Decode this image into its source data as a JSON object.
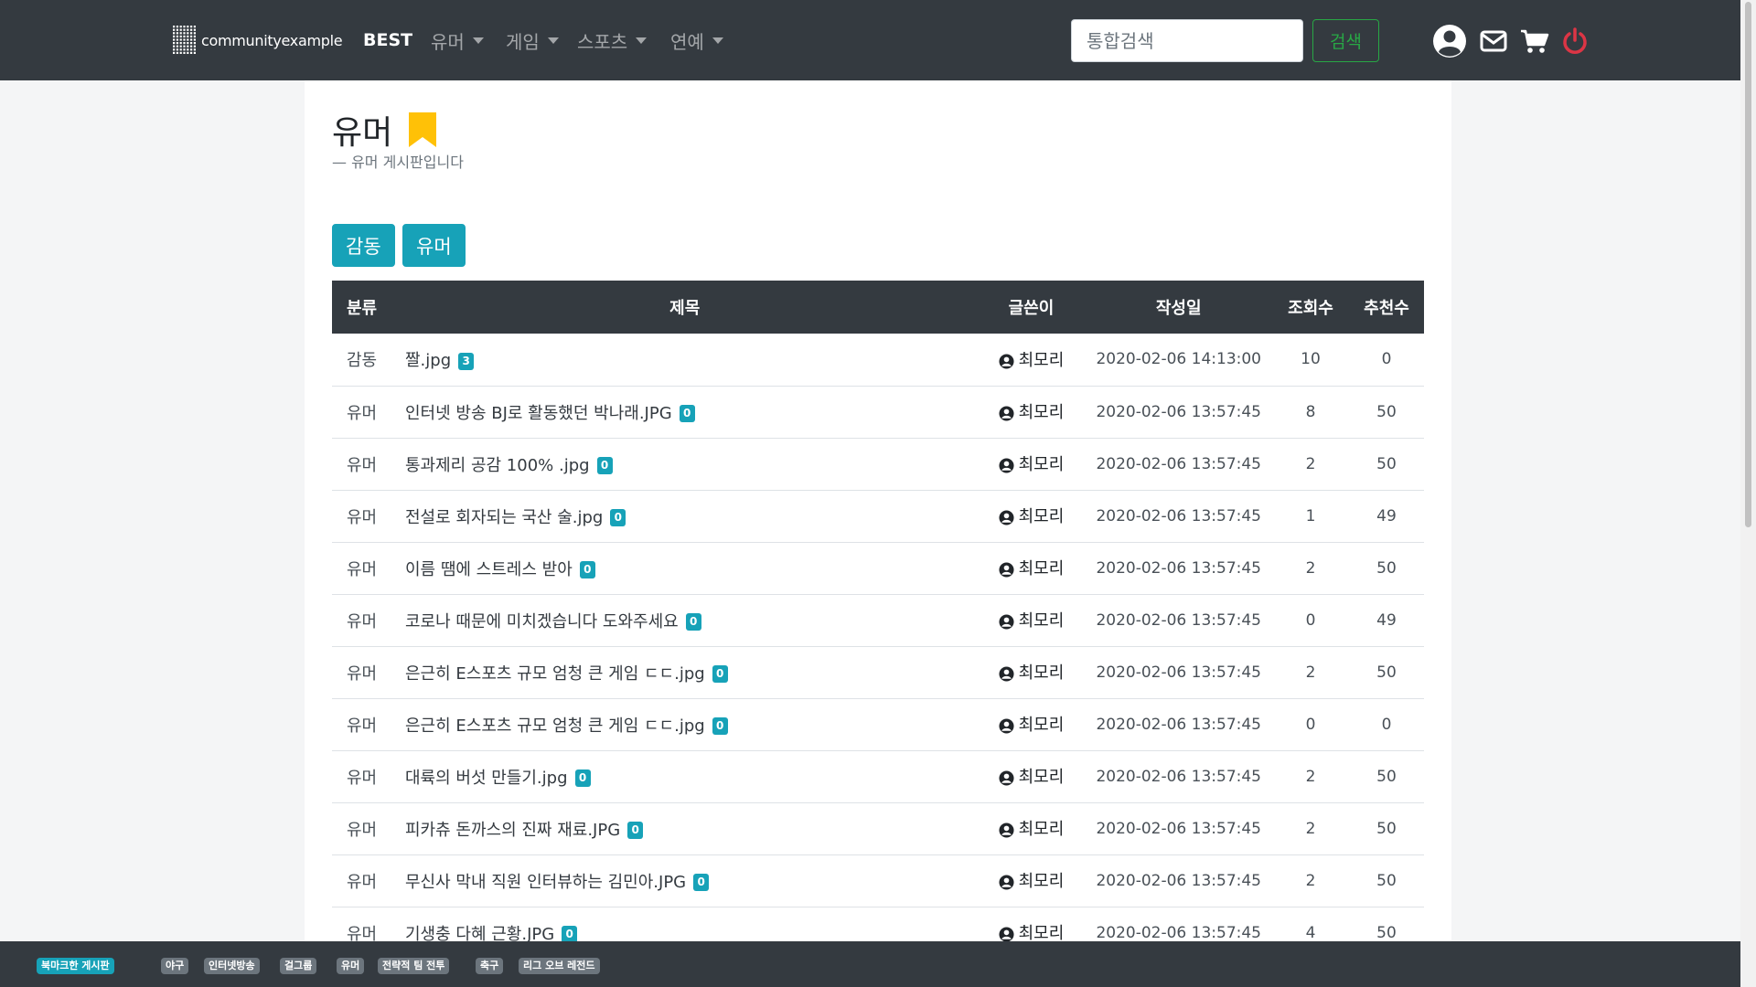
{
  "navbar": {
    "brand": "communityexample",
    "items": [
      {
        "label": "BEST",
        "dropdown": false
      },
      {
        "label": "유머",
        "dropdown": true
      },
      {
        "label": "게임",
        "dropdown": true
      },
      {
        "label": "스포츠",
        "dropdown": true
      },
      {
        "label": "연예",
        "dropdown": true
      }
    ],
    "search_placeholder": "통합검색",
    "search_button": "검색",
    "icons": [
      "user-circle-icon",
      "envelope-icon",
      "cart-icon",
      "power-icon"
    ],
    "power_color": "#dc3545"
  },
  "board": {
    "title": "유머",
    "subtitle": "— 유머 게시판입니다",
    "bookmark_color": "#ffc107",
    "categories": [
      "감동",
      "유머"
    ]
  },
  "table": {
    "headers": [
      "분류",
      "제목",
      "글쓴이",
      "작성일",
      "조회수",
      "추천수"
    ],
    "rows": [
      {
        "cat": "감동",
        "title": "짤.jpg",
        "comments": "3",
        "author": "최모리",
        "date": "2020-02-06 14:13:00",
        "views": "10",
        "recs": "0"
      },
      {
        "cat": "유머",
        "title": "인터넷 방송 BJ로 활동했던 박나래.JPG",
        "comments": "0",
        "author": "최모리",
        "date": "2020-02-06 13:57:45",
        "views": "8",
        "recs": "50"
      },
      {
        "cat": "유머",
        "title": "통과제리 공감 100% .jpg",
        "comments": "0",
        "author": "최모리",
        "date": "2020-02-06 13:57:45",
        "views": "2",
        "recs": "50"
      },
      {
        "cat": "유머",
        "title": "전설로 회자되는 국산 술.jpg",
        "comments": "0",
        "author": "최모리",
        "date": "2020-02-06 13:57:45",
        "views": "1",
        "recs": "49"
      },
      {
        "cat": "유머",
        "title": "이름 땜에 스트레스 받아",
        "comments": "0",
        "author": "최모리",
        "date": "2020-02-06 13:57:45",
        "views": "2",
        "recs": "50"
      },
      {
        "cat": "유머",
        "title": "코로나 때문에 미치겠습니다 도와주세요",
        "comments": "0",
        "author": "최모리",
        "date": "2020-02-06 13:57:45",
        "views": "0",
        "recs": "49"
      },
      {
        "cat": "유머",
        "title": "은근히 E스포츠 규모 엄청 큰 게임 ㄷㄷ.jpg",
        "comments": "0",
        "author": "최모리",
        "date": "2020-02-06 13:57:45",
        "views": "2",
        "recs": "50"
      },
      {
        "cat": "유머",
        "title": "은근히 E스포츠 규모 엄청 큰 게임 ㄷㄷ.jpg",
        "comments": "0",
        "author": "최모리",
        "date": "2020-02-06 13:57:45",
        "views": "0",
        "recs": "0"
      },
      {
        "cat": "유머",
        "title": "대륙의 버섯 만들기.jpg",
        "comments": "0",
        "author": "최모리",
        "date": "2020-02-06 13:57:45",
        "views": "2",
        "recs": "50"
      },
      {
        "cat": "유머",
        "title": "피카츄 돈까스의 진짜 재료.JPG",
        "comments": "0",
        "author": "최모리",
        "date": "2020-02-06 13:57:45",
        "views": "2",
        "recs": "50"
      },
      {
        "cat": "유머",
        "title": "무신사 막내 직원 인터뷰하는 김민아.JPG",
        "comments": "0",
        "author": "최모리",
        "date": "2020-02-06 13:57:45",
        "views": "2",
        "recs": "50"
      },
      {
        "cat": "유머",
        "title": "기생충 다혜 근황.JPG",
        "comments": "0",
        "author": "최모리",
        "date": "2020-02-06 13:57:45",
        "views": "4",
        "recs": "50"
      }
    ]
  },
  "footer": {
    "bookmark_label": "북마크한 게시판",
    "boards": [
      "야구",
      "인터넷방송",
      "걸그룹",
      "유머",
      "전략적 팀 전투",
      "축구",
      "리그 오브 레전드"
    ]
  }
}
